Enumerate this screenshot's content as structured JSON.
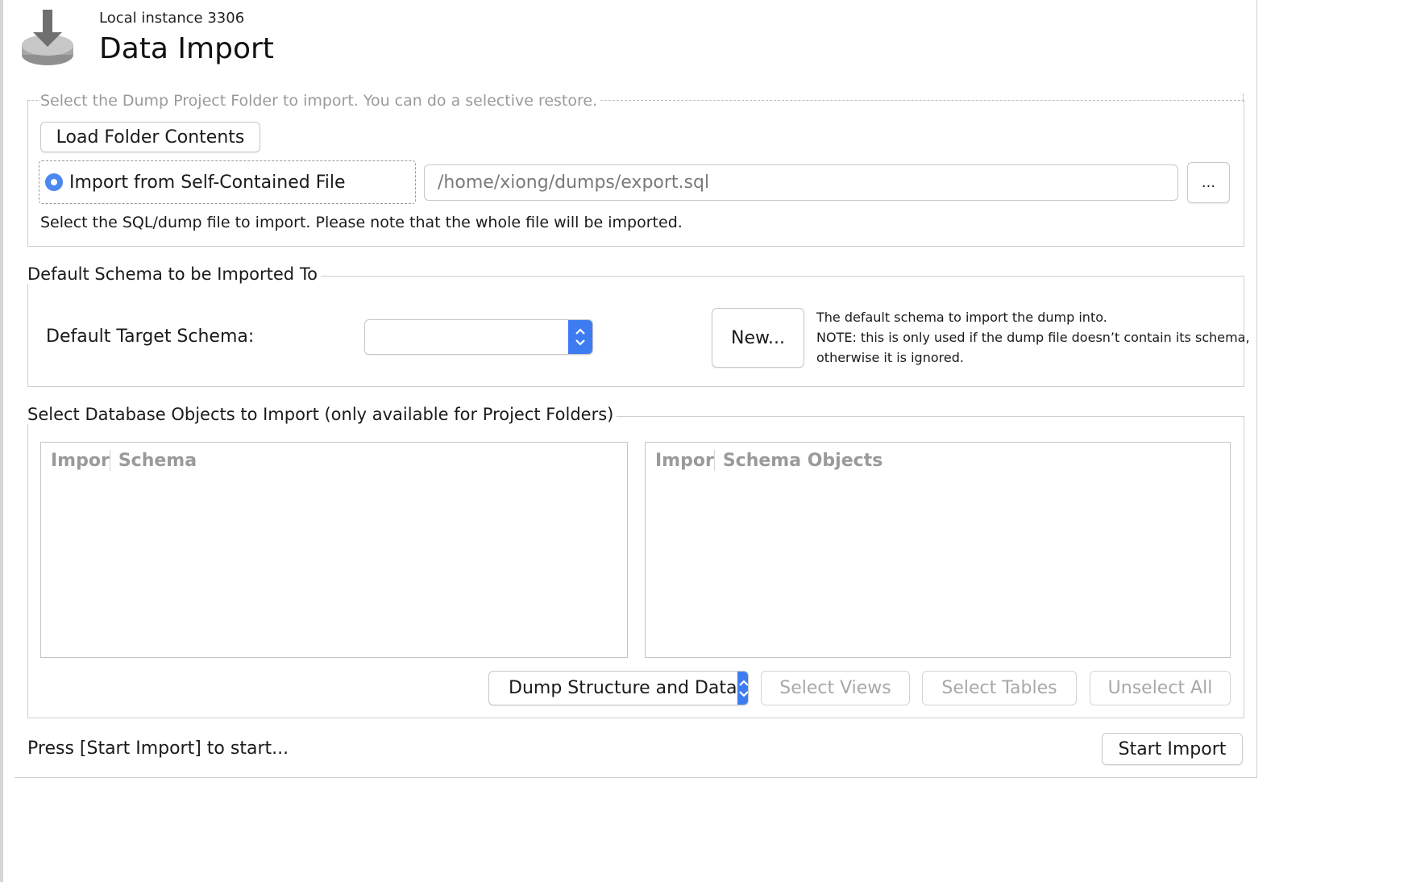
{
  "header": {
    "subtitle": "Local instance 3306",
    "title": "Data Import",
    "icon": "import-download-icon"
  },
  "import_options": {
    "folder_hint": "Select the Dump Project Folder to import. You can do a selective restore.",
    "load_folder_button": "Load Folder Contents",
    "self_contained_radio": "Import from Self-Contained File",
    "self_contained_selected": true,
    "file_path": "/home/xiong/dumps/export.sql",
    "browse_button": "...",
    "file_hint": "Select the SQL/dump file to import. Please note that the whole file will be imported."
  },
  "default_schema": {
    "section_title": "Default Schema to be Imported To",
    "target_label": "Default Target Schema:",
    "target_value": "",
    "new_button": "New...",
    "note_line1": "The default schema to import the dump into.",
    "note_line2": "NOTE: this is only used if the dump file doesn’t contain its schema,",
    "note_line3": "otherwise it is ignored."
  },
  "objects": {
    "section_title": "Select Database Objects to Import (only available for Project Folders)",
    "schema_list": {
      "col_import": "Impor",
      "col_name": "Schema"
    },
    "objects_list": {
      "col_import": "Impor",
      "col_name": "Schema Objects"
    },
    "dump_mode": "Dump Structure and Data",
    "select_views": "Select Views",
    "select_tables": "Select Tables",
    "unselect_all": "Unselect All"
  },
  "footer": {
    "status": "Press [Start Import] to start...",
    "start_button": "Start Import"
  },
  "colors": {
    "accent": "#3d7cf0",
    "radio": "#4c87f2",
    "disabled_text": "#a8a8a8"
  }
}
